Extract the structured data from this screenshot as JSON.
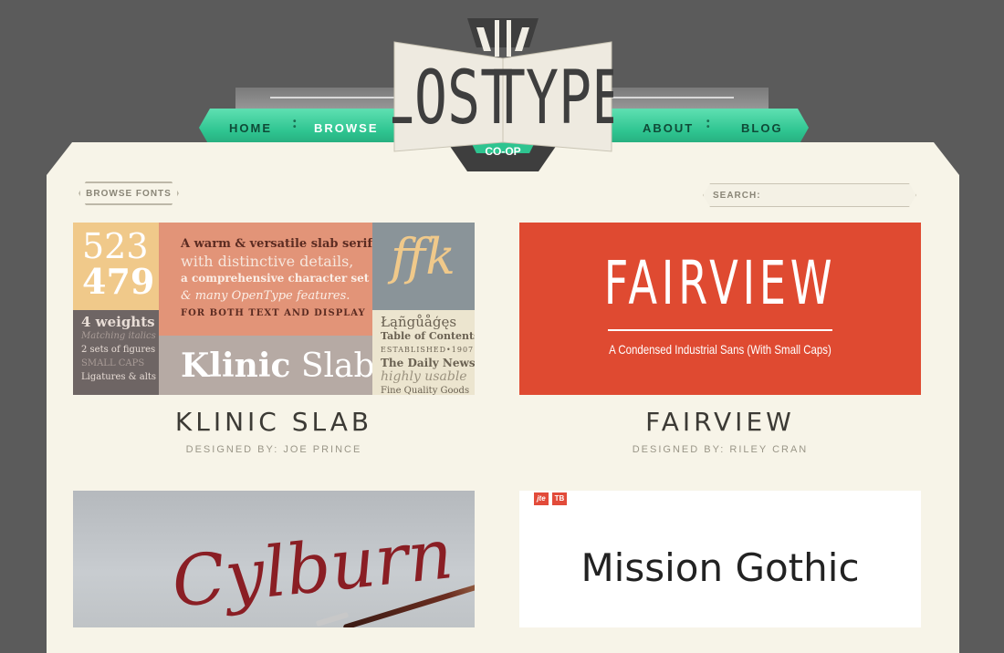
{
  "logo": {
    "word1": "LOST",
    "word2": "TYPE",
    "sub": "CO-OP"
  },
  "nav": {
    "home": "HOME",
    "browse": "BROWSE",
    "about": "ABOUT",
    "blog": "BLOG"
  },
  "breadcrumb": {
    "label": "BROWSE FONTS"
  },
  "search": {
    "label": "SEARCH:",
    "value": "",
    "placeholder": ""
  },
  "colors": {
    "accent": "#2ec490",
    "panel": "#f7f4e8",
    "background": "#5b5b5b"
  },
  "fonts": [
    {
      "name": "KLINIC SLAB",
      "designer": "DESIGNED BY: JOE PRINCE",
      "specimen": {
        "num1": "523",
        "num2": "479",
        "blurb": [
          "A warm & versatile slab serif",
          "with distinctive details,",
          "a comprehensive character set",
          "& many OpenType features.",
          "FOR BOTH TEXT AND DISPLAY"
        ],
        "ligature": "ffk",
        "weights": [
          "4 weights",
          "Matching italics",
          "2 sets of figures",
          "SMALL CAPS",
          "Ligatures & alts"
        ],
        "name_a": "Klinic",
        "name_b": "Slab",
        "samples": [
          "Łąñgůåģęs",
          "Table of Contents",
          "ESTABLISHED•1907",
          "The Daily News",
          "highly usable",
          "Fine Quality Goods"
        ]
      }
    },
    {
      "name": "FAIRVIEW",
      "designer": "DESIGNED BY: RILEY CRAN",
      "specimen": {
        "big": "FAIRVIEW",
        "sub": "A Condensed Industrial Sans (With Small Caps)"
      }
    },
    {
      "name": "",
      "designer": "",
      "specimen": {
        "script": "Cylburn"
      }
    },
    {
      "name": "",
      "designer": "",
      "specimen": {
        "badge1": "jte",
        "badge2": "TB",
        "title": "Mission Gothic"
      }
    }
  ]
}
